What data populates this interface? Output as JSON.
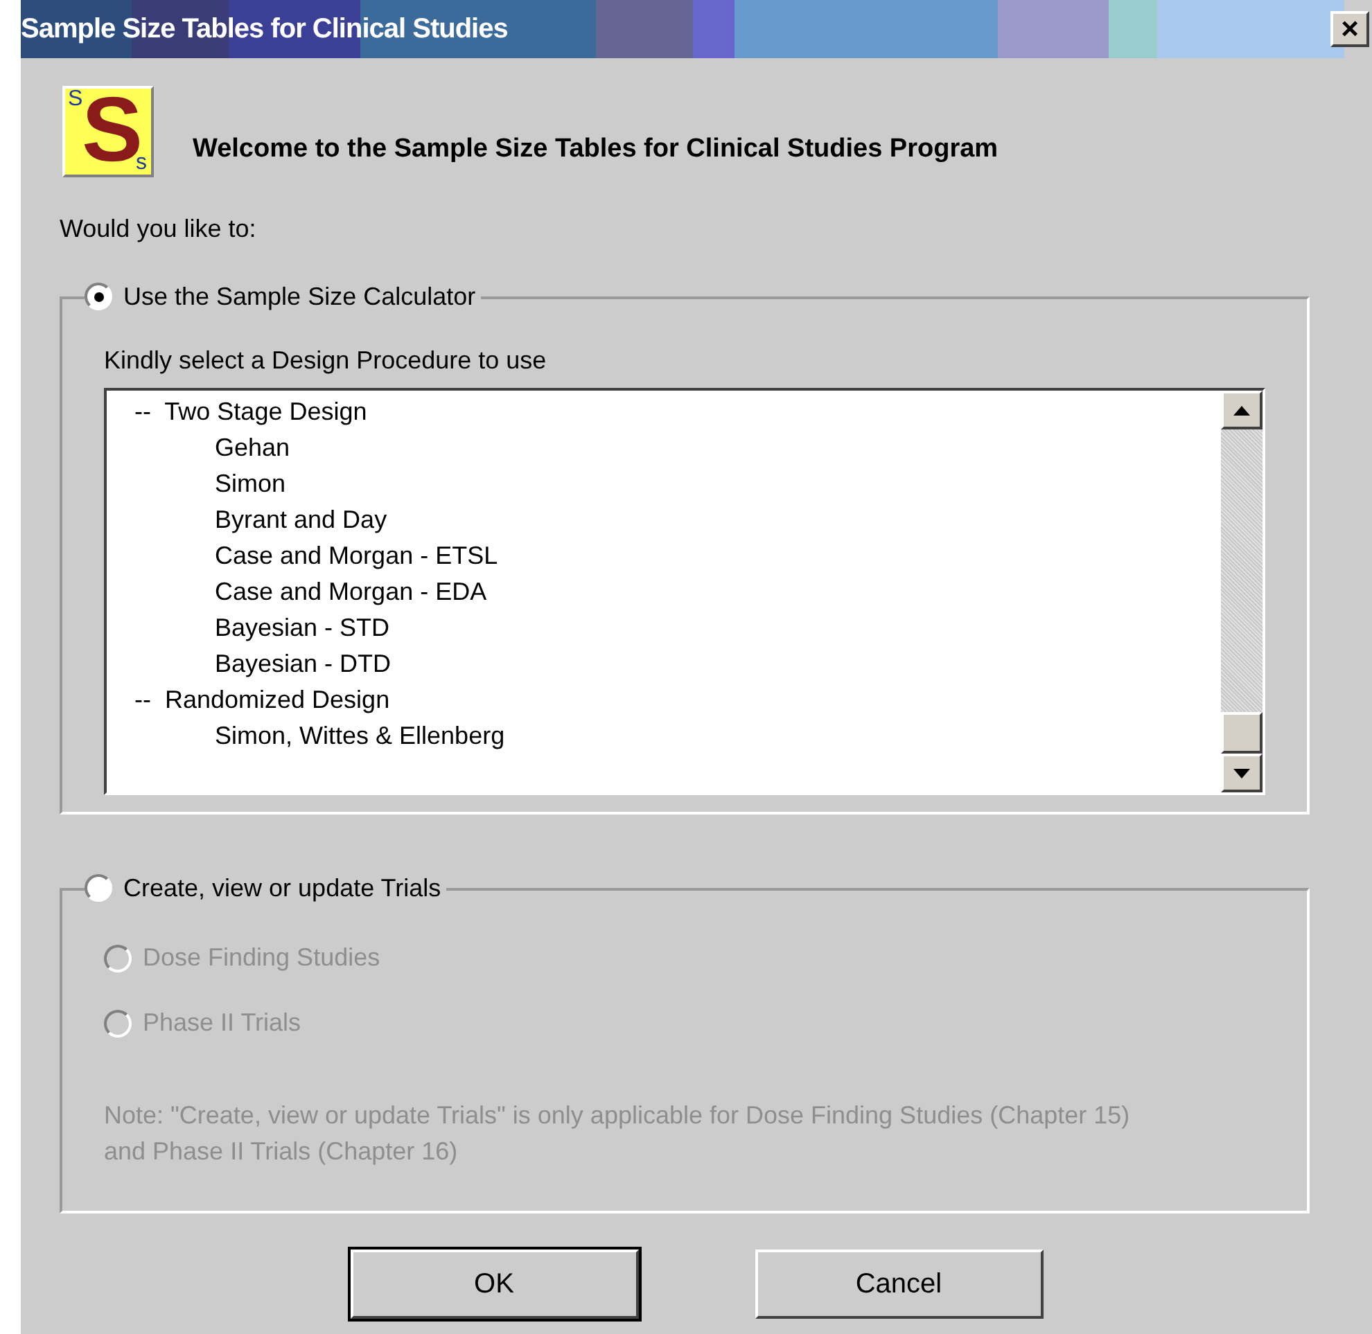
{
  "window": {
    "title": "Sample Size Tables for Clinical Studies",
    "close": "×"
  },
  "logo": {
    "letter": "S",
    "corner_top": "S",
    "corner_bottom": "s"
  },
  "welcome": "Welcome to the Sample Size Tables for Clinical Studies Program",
  "prompt": "Would you like to:",
  "groups": [
    {
      "label": "Use the Sample Size Calculator",
      "selected": true,
      "kind": "calculator",
      "caption": "Kindly select a Design Procedure to use",
      "procedures": [
        {
          "label": "--  Two Stage Design",
          "children": [
            {
              "label": "Gehan"
            },
            {
              "label": "Simon"
            },
            {
              "label": "Byrant and Day"
            },
            {
              "label": "Case and Morgan - ETSL"
            },
            {
              "label": "Case and Morgan - EDA"
            },
            {
              "label": "Bayesian - STD"
            },
            {
              "label": "Bayesian - DTD"
            }
          ]
        },
        {
          "label": "--  Randomized Design",
          "children": [
            {
              "label": "Simon, Wittes & Ellenberg"
            }
          ]
        }
      ]
    },
    {
      "label": "Create, view or update Trials",
      "selected": false,
      "kind": "trials",
      "options": [
        {
          "label": "Dose Finding Studies",
          "selected": false,
          "disabled": true
        },
        {
          "label": "Phase II Trials",
          "selected": false,
          "disabled": true
        }
      ],
      "note": "Note: \"Create, view or update Trials\" is only applicable for Dose Finding Studies (Chapter 15) and Phase II Trials (Chapter 16)"
    }
  ],
  "buttons": [
    {
      "label": "OK",
      "default": true
    },
    {
      "label": "Cancel",
      "default": false
    }
  ]
}
